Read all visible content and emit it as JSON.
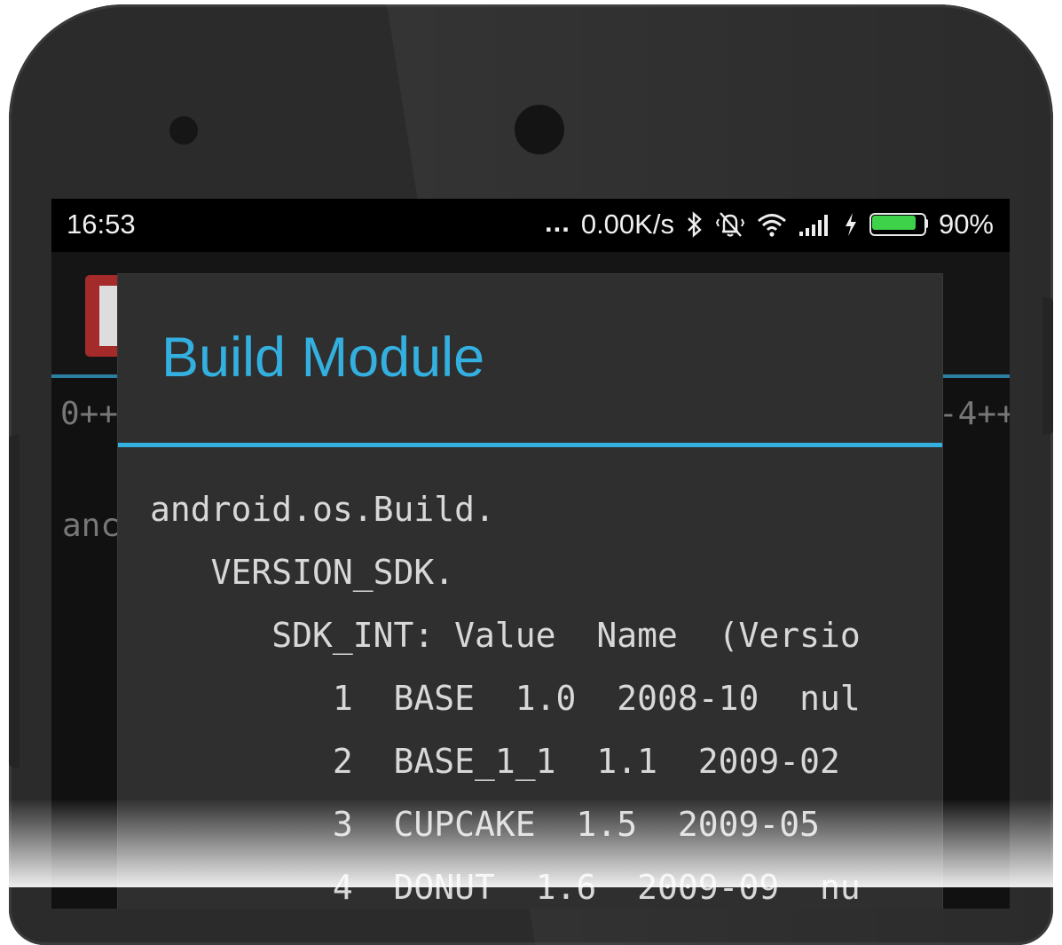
{
  "status_bar": {
    "time": "16:53",
    "dots": "...",
    "network_speed": "0.00K/s",
    "signal_bars": 4,
    "battery_percent_text": "90%",
    "battery_level": 0.9,
    "icons": [
      "bluetooth-icon",
      "vibrate-silent-icon",
      "wifi-icon",
      "signal-icon",
      "charging-icon",
      "battery-icon"
    ]
  },
  "background_app": {
    "row_left": "0++",
    "row_right": "-4++",
    "text_left": "anc"
  },
  "dialog": {
    "title": "Build Module",
    "accent_color": "#33b0e0",
    "lines": [
      "android.os.Build.",
      "   VERSION_SDK.",
      "      SDK_INT: Value  Name  (Versio",
      "         1  BASE  1.0  2008-10  nul",
      "         2  BASE_1_1  1.1  2009-02",
      "         3  CUPCAKE  1.5  2009-05",
      "         4  DONUT  1.6  2009-09  nu"
    ]
  }
}
